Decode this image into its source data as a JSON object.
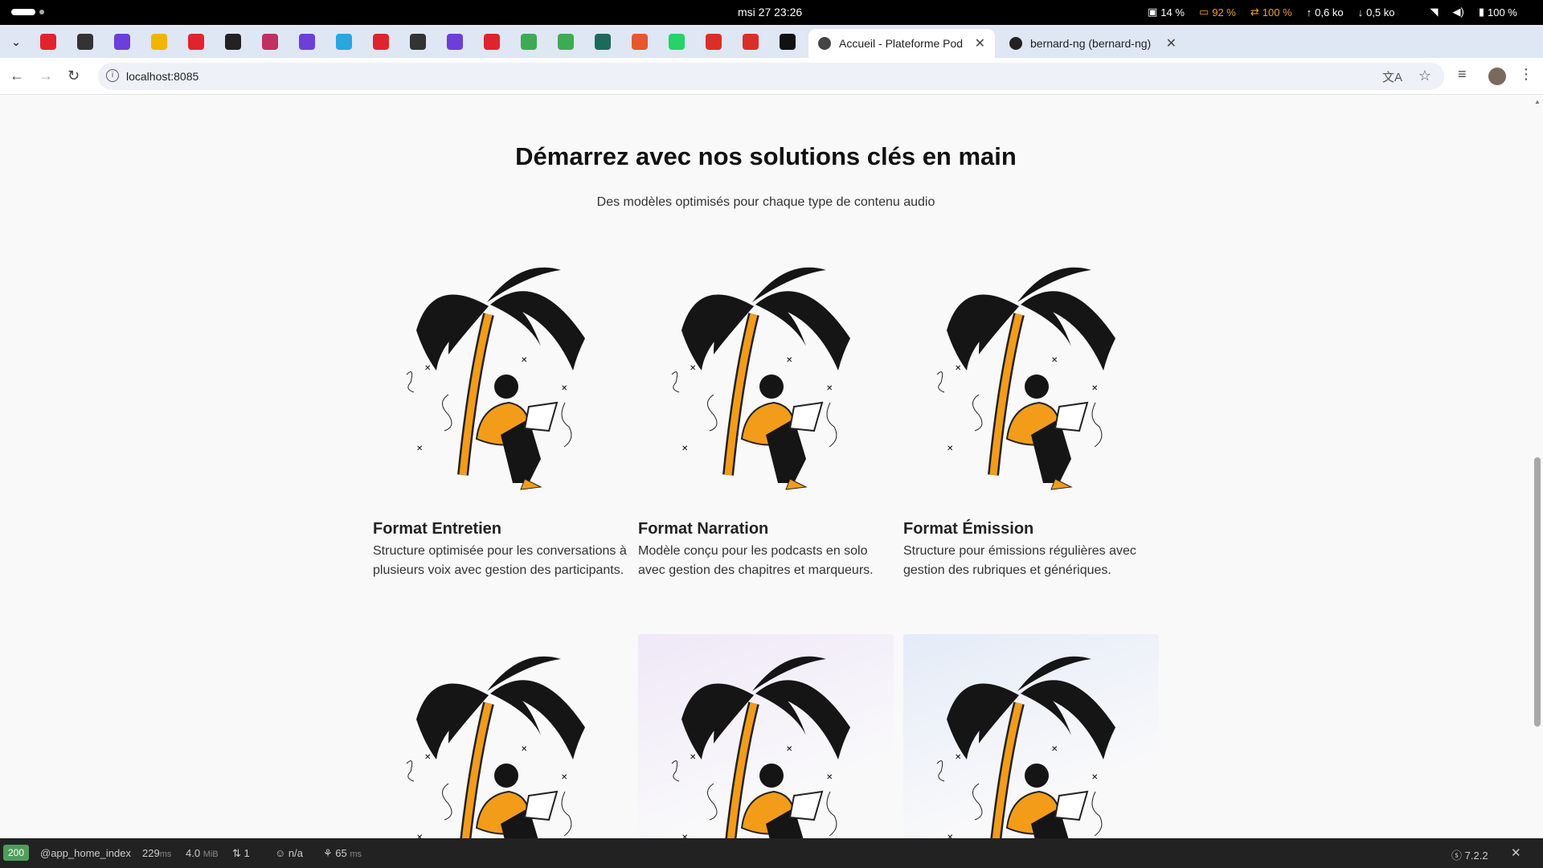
{
  "system": {
    "clock": "msi 27  23:26",
    "cpu": "14 %",
    "mem": "92 %",
    "swap": "100 %",
    "up": "0,6 ko",
    "down": "0,5 ko",
    "battery": "100 %"
  },
  "tabs": [
    {
      "title": "Accueil - Plateforme Pod",
      "active": true
    },
    {
      "title": "bernard-ng (bernard-ng)",
      "active": false
    }
  ],
  "pinned_icons": [
    "youtube-icon",
    "refresh-icon",
    "app-icon",
    "keep-icon",
    "youtube-icon",
    "github-dark-icon",
    "spiral-icon",
    "app-icon",
    "tailwind-icon",
    "youtube-icon",
    "symfony-icon",
    "app-icon",
    "youtube-icon",
    "android-icon",
    "android-icon",
    "vpn-icon",
    "link-icon",
    "whatsapp-icon",
    "gmail-icon",
    "gmail-icon",
    "github-icon"
  ],
  "address": {
    "url": "localhost:8085"
  },
  "page": {
    "heading": "Démarrez avec nos solutions clés en main",
    "subheading": "Des modèles optimisés pour chaque type de contenu audio",
    "cards": [
      {
        "title": "Format Entretien",
        "desc": "Structure optimisée pour les conversations à plusieurs voix avec gestion des participants."
      },
      {
        "title": "Format Narration",
        "desc": "Modèle conçu pour les podcasts en solo avec gestion des chapitres et marqueurs."
      },
      {
        "title": "Format Émission",
        "desc": "Structure pour émissions régulières avec gestion des rubriques et génériques."
      }
    ]
  },
  "devbar": {
    "status": "200",
    "route": "@app_home_index",
    "time": "229",
    "time_unit": "ms",
    "memory": "4.0",
    "memory_unit": "MiB",
    "requests": "1",
    "user": "n/a",
    "render": "65",
    "render_unit": "ms",
    "version": "7.2.2"
  }
}
